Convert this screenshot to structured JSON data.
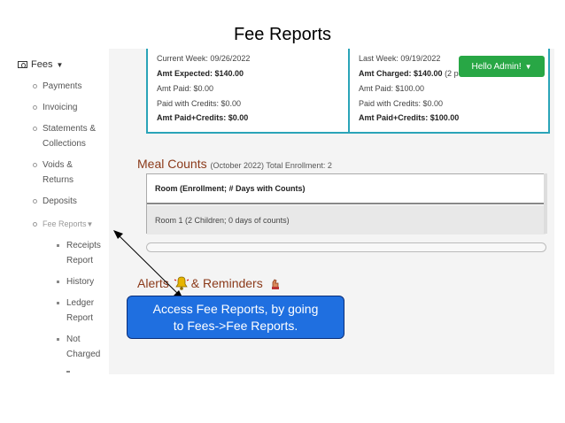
{
  "slide_title": "Fee Reports",
  "sidebar": {
    "fees_label": "Fees",
    "items": [
      {
        "label": "Payments"
      },
      {
        "label": "Invoicing"
      },
      {
        "label_1": "Statements &",
        "label_2": "Collections"
      },
      {
        "label_1": "Voids &",
        "label_2": "Returns"
      },
      {
        "label": "Deposits"
      },
      {
        "label": "Fee Reports"
      }
    ],
    "sub_items": [
      {
        "label_1": "Receipts",
        "label_2": "Report"
      },
      {
        "label": "History"
      },
      {
        "label_1": "Ledger",
        "label_2": "Report"
      },
      {
        "label_1": "Not",
        "label_2": "Charged"
      }
    ]
  },
  "current_week": {
    "week": "Current Week: 09/26/2022",
    "amt_expected": "Amt Expected: $140.00",
    "amt_paid": "Amt Paid: $0.00",
    "paid_credits": "Paid with Credits: $0.00",
    "amt_paid_credits": "Amt Paid+Credits: $0.00"
  },
  "last_week": {
    "week": "Last Week: 09/19/2022",
    "amt_charged": "Amt Charged: $140.00",
    "partial": "(2 p",
    "amt_paid": "Amt Paid: $100.00",
    "paid_credits": "Paid with Credits: $0.00",
    "amt_paid_credits": "Amt Paid+Credits: $100.00"
  },
  "hello_button": "Hello Admin!",
  "meal_counts": {
    "title": "Meal Counts",
    "subtitle": "(October 2022) Total Enrollment: 2",
    "header": "Room (Enrollment; # Days with Counts)",
    "row": "Room 1   (2 Children; 0 days of counts)"
  },
  "alerts": {
    "part1": "Alerts",
    "part2": "& Reminders"
  },
  "callout": {
    "line1": "Access Fee Reports, by going",
    "line2": "to Fees->Fee Reports."
  },
  "colors": {
    "accent_teal": "#2aa4b8",
    "button_green": "#28a745",
    "heading_brown": "#8b3a1a",
    "callout_blue": "#1f6fe0"
  }
}
